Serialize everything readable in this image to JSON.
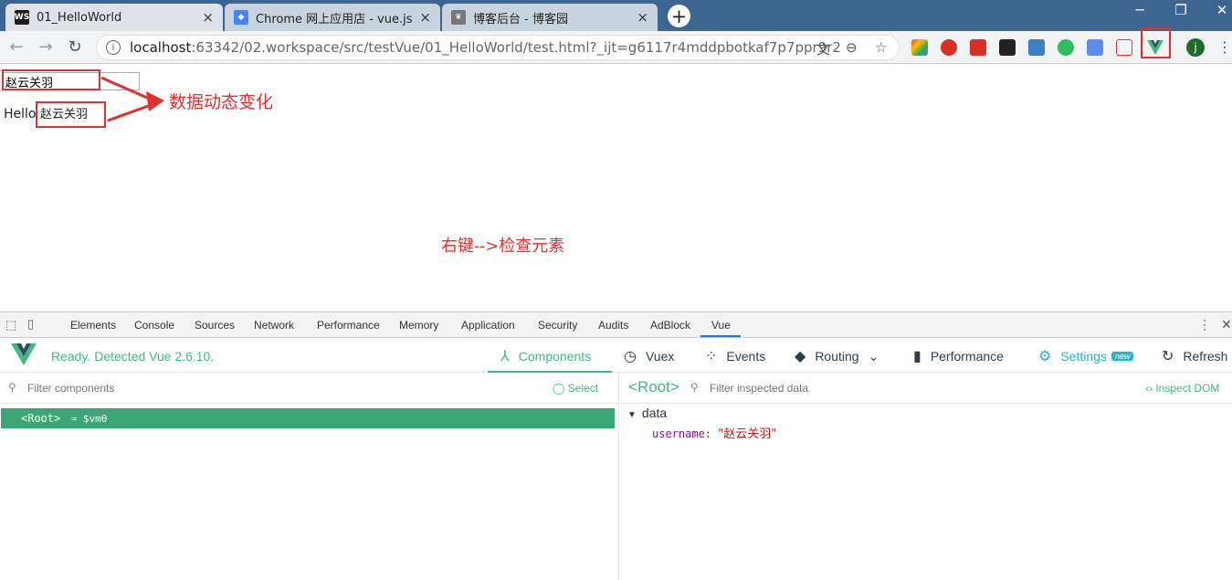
{
  "browser": {
    "tabs": [
      {
        "favicon": "WS",
        "favicon_color": "#1c1c1c",
        "label": "01_HelloWorld",
        "close": "×"
      },
      {
        "favicon": "◆",
        "favicon_color": "#4285f4",
        "label": "Chrome 网上应用店 - vue.js de",
        "close": "×"
      },
      {
        "favicon": "❦",
        "favicon_color": "#555555",
        "label": "博客后台 - 博客园",
        "close": "×"
      }
    ],
    "new_tab": "+",
    "window_controls": {
      "minimize": "─",
      "restore": "❐",
      "close": "✕"
    },
    "nav": {
      "back": "←",
      "forward": "→",
      "reload": "↻"
    },
    "url": {
      "host": "localhost",
      "rest": ":63342/02.workspace/src/testVue/01_HelloWorld/test.html?_ijt=g6117r4mddpbotkaf7p7ppr9r2"
    },
    "omni_icons": {
      "translate": "文",
      "zoom": "⊖",
      "bookmark": "☆"
    },
    "profile": "j",
    "menu": "⋮"
  },
  "page": {
    "input_value": "赵云关羽",
    "hello_prefix": "Hello",
    "hello_value": "赵云关羽",
    "annotation_change": "数据动态变化",
    "annotation_inspect": "右键-->检查元素"
  },
  "devtools": {
    "tabs": [
      "Elements",
      "Console",
      "Sources",
      "Network",
      "Performance",
      "Memory",
      "Application",
      "Security",
      "Audits",
      "AdBlock",
      "Vue"
    ],
    "active_tab": "Vue",
    "vue": {
      "status": "Ready. Detected Vue 2.6.10.",
      "nav": {
        "components": "Components",
        "vuex": "Vuex",
        "events": "Events",
        "routing": "Routing",
        "performance": "Performance",
        "settings": "Settings",
        "settings_badge": "new",
        "refresh": "Refresh"
      },
      "filter_components_placeholder": "Filter components",
      "select_label": "Select",
      "root_tag": "Root",
      "root_assign": "= $vm0",
      "inspected_title": "Root",
      "filter_inspected_placeholder": "Filter inspected data",
      "inspect_dom": "Inspect DOM",
      "data_section": "data",
      "prop_key": "username",
      "prop_value": "\"赵云关羽\""
    }
  },
  "colors": {
    "vue_green": "#42b983",
    "annotation_red": "#e03030",
    "titlebar": "#3c6591"
  }
}
